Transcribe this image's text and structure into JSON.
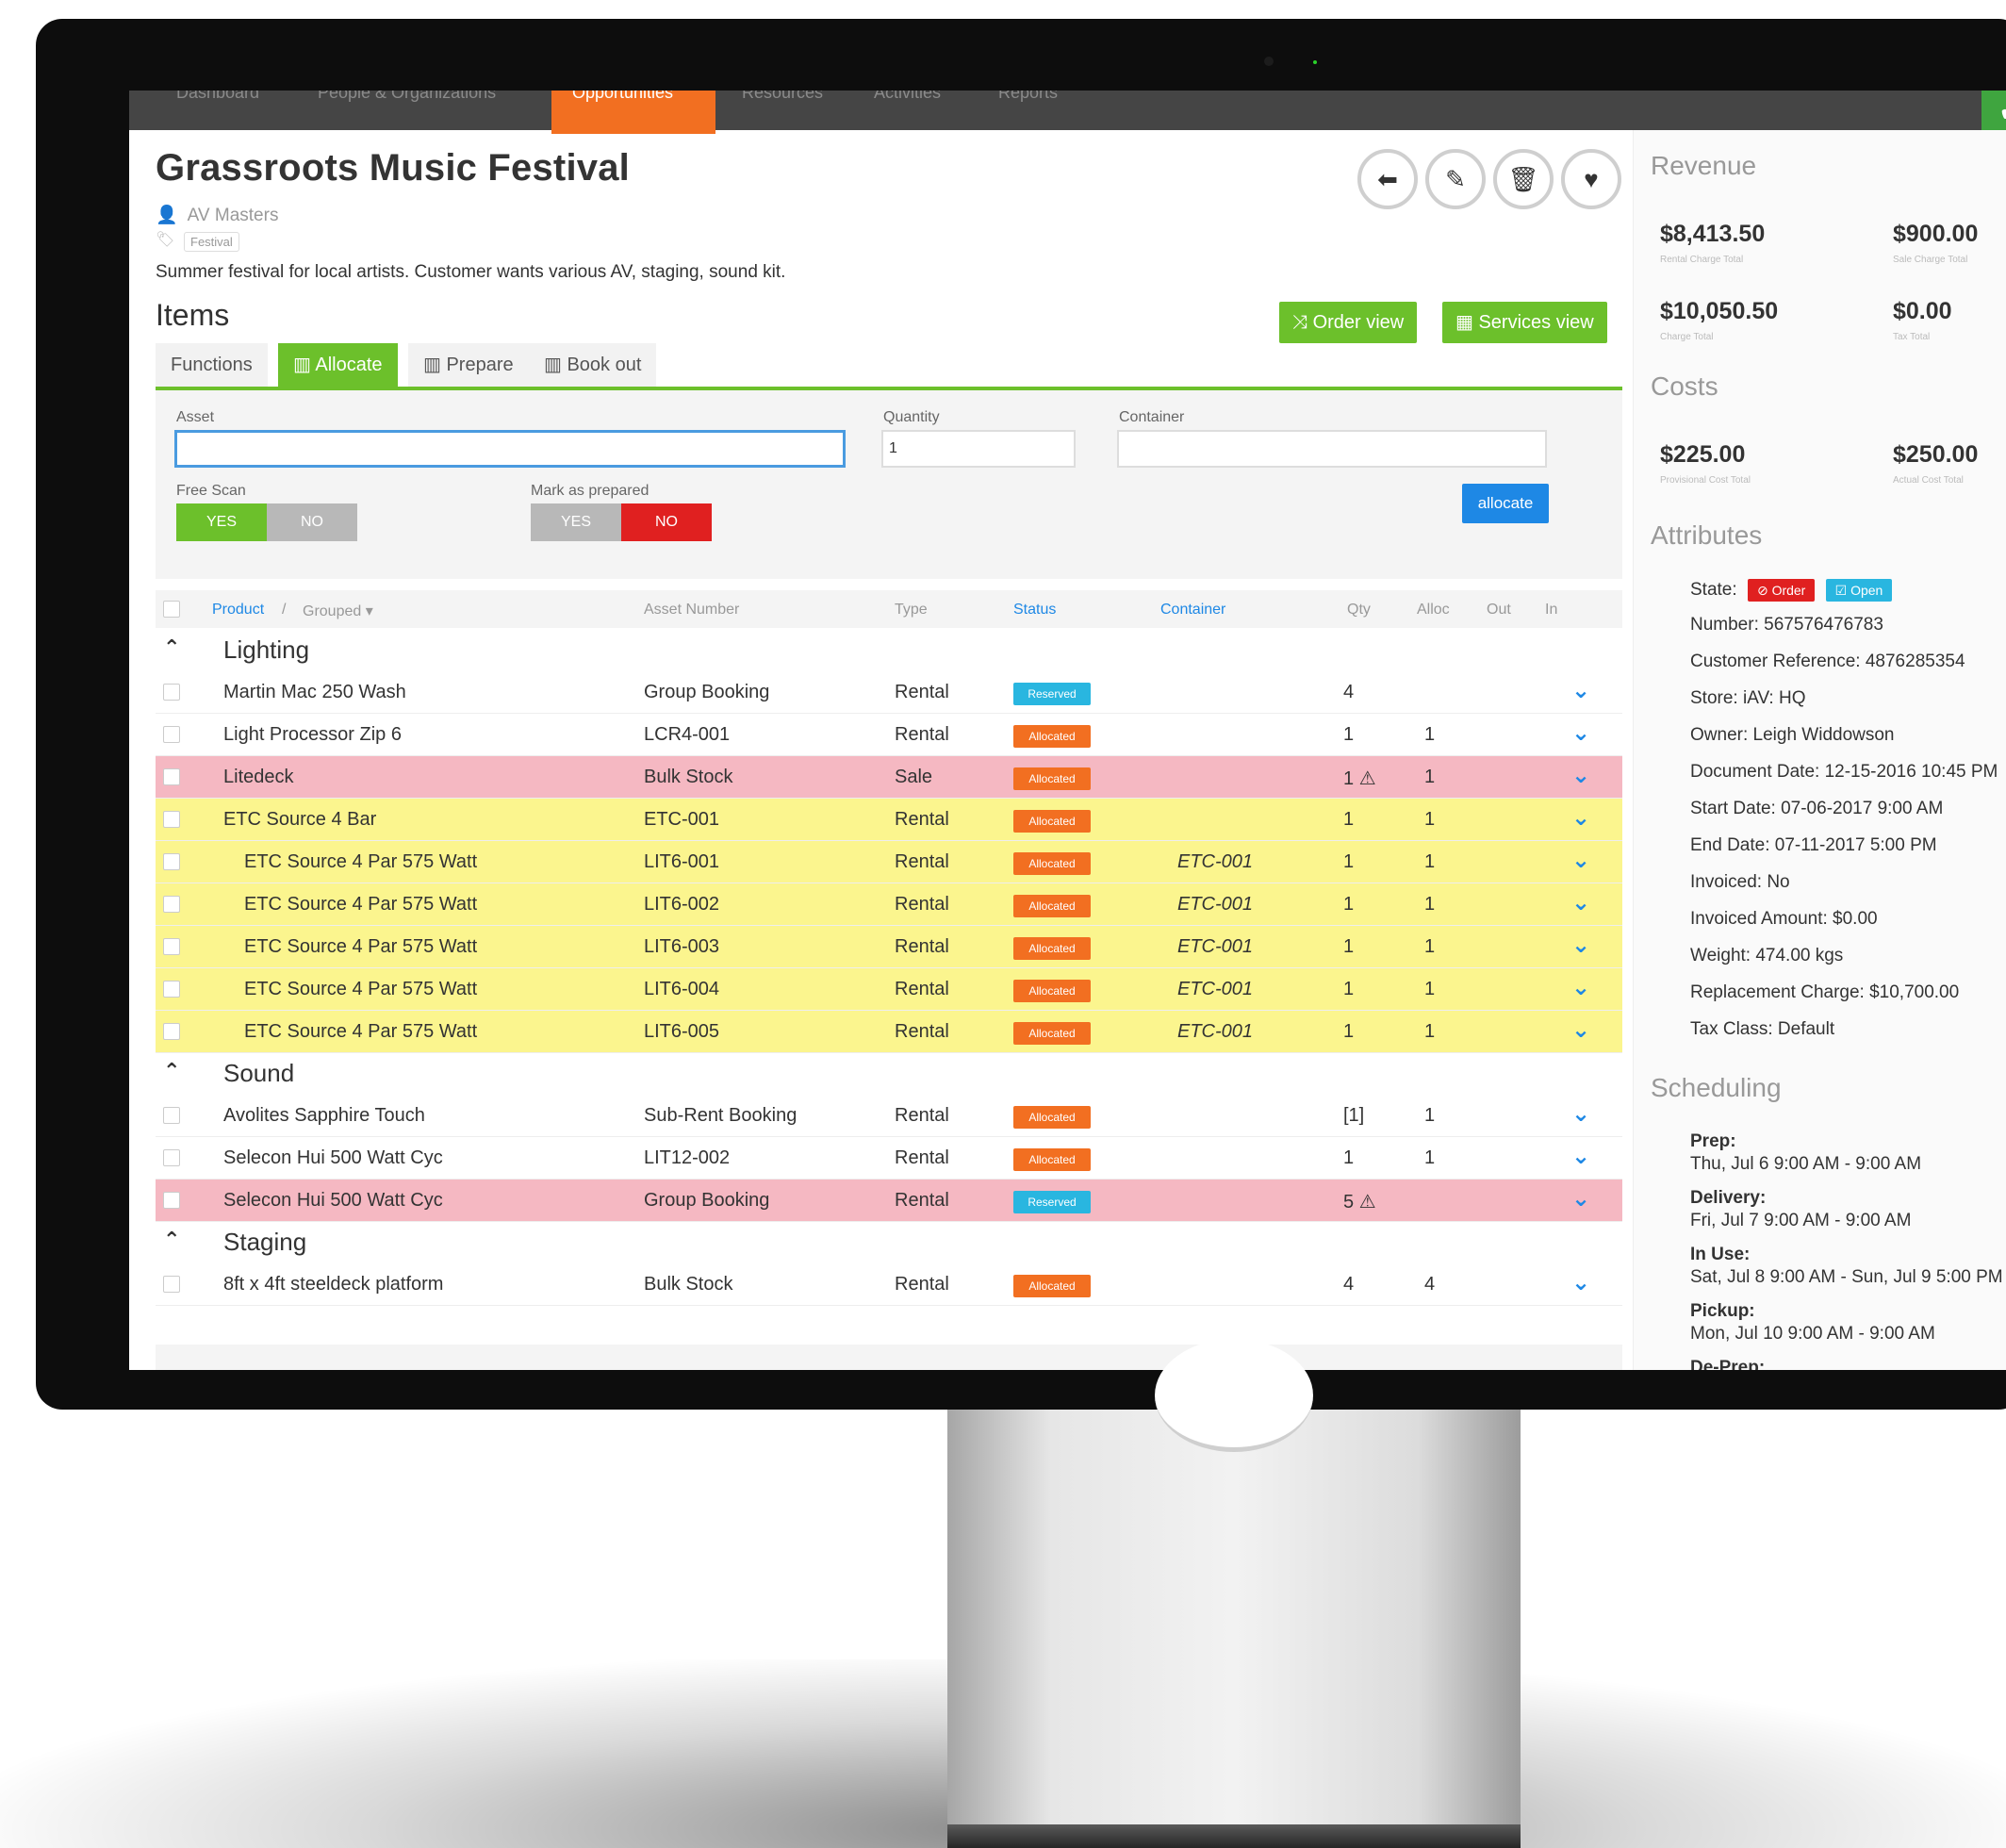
{
  "nav": {
    "items": [
      "Dashboard",
      "People & Organizations",
      "Opportunities",
      "Resources",
      "Activities",
      "Reports"
    ],
    "active": "Opportunities",
    "confirm_icon": "check-icon"
  },
  "header": {
    "title": "Grassroots Music Festival",
    "owner": "AV Masters",
    "tag": "Festival",
    "description": "Summer festival for local artists. Customer wants various AV, staging, sound kit.",
    "items_heading": "Items",
    "actions": [
      "back-arrow-icon",
      "pencil-icon",
      "trash-icon",
      "heart-icon"
    ]
  },
  "views": {
    "order_view": "Order view",
    "services_view": "Services view"
  },
  "tabs": [
    "Functions",
    "Allocate",
    "Prepare",
    "Book out"
  ],
  "active_tab": "Allocate",
  "form": {
    "asset_label": "Asset",
    "asset_value": "",
    "quantity_label": "Quantity",
    "quantity_value": "1",
    "container_label": "Container",
    "container_value": "",
    "free_scan_label": "Free Scan",
    "free_scan_yes": "YES",
    "free_scan_no": "NO",
    "mark_prepared_label": "Mark as prepared",
    "mark_prepared_yes": "YES",
    "mark_prepared_no": "NO",
    "allocate_button": "allocate"
  },
  "table": {
    "headers": {
      "product": "Product",
      "grouped": "Grouped",
      "asset_number": "Asset Number",
      "type": "Type",
      "status": "Status",
      "container": "Container",
      "qty": "Qty",
      "alloc": "Alloc",
      "out": "Out",
      "in": "In"
    },
    "groups": [
      {
        "name": "Lighting",
        "rows": [
          {
            "product": "Martin Mac 250 Wash",
            "asset": "Group Booking",
            "type": "Rental",
            "status": "Reserved",
            "container": "",
            "qty": "4",
            "alloc": "",
            "highlight": "none",
            "indent": false
          },
          {
            "product": "Light Processor Zip 6",
            "asset": "LCR4-001",
            "type": "Rental",
            "status": "Allocated",
            "container": "",
            "qty": "1",
            "alloc": "1",
            "highlight": "none",
            "indent": false
          },
          {
            "product": "Litedeck",
            "asset": "Bulk Stock",
            "type": "Sale",
            "status": "Allocated",
            "container": "",
            "qty": "1 ⚠",
            "alloc": "1",
            "highlight": "pink",
            "indent": false
          },
          {
            "product": "ETC Source 4 Bar",
            "asset": "ETC-001",
            "type": "Rental",
            "status": "Allocated",
            "container": "",
            "qty": "1",
            "alloc": "1",
            "highlight": "yellow",
            "indent": false
          },
          {
            "product": "ETC Source 4 Par 575 Watt",
            "asset": "LIT6-001",
            "type": "Rental",
            "status": "Allocated",
            "container": "ETC-001",
            "qty": "1",
            "alloc": "1",
            "highlight": "yellow",
            "indent": true
          },
          {
            "product": "ETC Source 4 Par 575 Watt",
            "asset": "LIT6-002",
            "type": "Rental",
            "status": "Allocated",
            "container": "ETC-001",
            "qty": "1",
            "alloc": "1",
            "highlight": "yellow",
            "indent": true
          },
          {
            "product": "ETC Source 4 Par 575 Watt",
            "asset": "LIT6-003",
            "type": "Rental",
            "status": "Allocated",
            "container": "ETC-001",
            "qty": "1",
            "alloc": "1",
            "highlight": "yellow",
            "indent": true
          },
          {
            "product": "ETC Source 4 Par 575 Watt",
            "asset": "LIT6-004",
            "type": "Rental",
            "status": "Allocated",
            "container": "ETC-001",
            "qty": "1",
            "alloc": "1",
            "highlight": "yellow",
            "indent": true
          },
          {
            "product": "ETC Source 4 Par 575 Watt",
            "asset": "LIT6-005",
            "type": "Rental",
            "status": "Allocated",
            "container": "ETC-001",
            "qty": "1",
            "alloc": "1",
            "highlight": "yellow",
            "indent": true
          }
        ]
      },
      {
        "name": "Sound",
        "rows": [
          {
            "product": "Avolites Sapphire Touch",
            "asset": "Sub-Rent Booking",
            "type": "Rental",
            "status": "Allocated",
            "container": "",
            "qty": "[1]",
            "alloc": "1",
            "highlight": "none",
            "indent": false
          },
          {
            "product": "Selecon Hui 500 Watt Cyc",
            "asset": "LIT12-002",
            "type": "Rental",
            "status": "Allocated",
            "container": "",
            "qty": "1",
            "alloc": "1",
            "highlight": "none",
            "indent": false
          },
          {
            "product": "Selecon Hui 500 Watt Cyc",
            "asset": "Group Booking",
            "type": "Rental",
            "status": "Reserved",
            "container": "",
            "qty": "5 ⚠",
            "alloc": "",
            "highlight": "pink",
            "indent": false
          }
        ]
      },
      {
        "name": "Staging",
        "rows": [
          {
            "product": "8ft x 4ft steeldeck platform",
            "asset": "Bulk Stock",
            "type": "Rental",
            "status": "Allocated",
            "container": "",
            "qty": "4",
            "alloc": "4",
            "highlight": "none",
            "indent": false
          }
        ]
      }
    ]
  },
  "sidebar": {
    "revenue_heading": "Revenue",
    "revenue": [
      {
        "value": "$8,413.50",
        "label": "Rental Charge Total"
      },
      {
        "value": "$900.00",
        "label": "Sale Charge Total"
      },
      {
        "value": "$10,050.50",
        "label": "Charge Total"
      },
      {
        "value": "$0.00",
        "label": "Tax Total"
      }
    ],
    "costs_heading": "Costs",
    "costs": [
      {
        "value": "$225.00",
        "label": "Provisional Cost Total"
      },
      {
        "value": "$250.00",
        "label": "Actual Cost Total"
      }
    ],
    "attributes_heading": "Attributes",
    "state_label": "State:",
    "state_badges": [
      {
        "text": "Order",
        "color": "#e02020"
      },
      {
        "text": "Open",
        "color": "#29b6e0"
      }
    ],
    "attributes": [
      "Number: 567576476783",
      "Customer Reference: 4876285354",
      "Store: iAV: HQ",
      "Owner: Leigh Widdowson",
      "Document Date: 12-15-2016 10:45 PM",
      "Start Date: 07-06-2017 9:00 AM",
      "End Date: 07-11-2017 5:00 PM",
      "Invoiced: No",
      "Invoiced Amount: $0.00",
      "Weight: 474.00 kgs",
      "Replacement Charge: $10,700.00",
      "Tax Class: Default"
    ],
    "scheduling_heading": "Scheduling",
    "scheduling": [
      {
        "label": "Prep:",
        "value": "Thu, Jul 6 9:00 AM - 9:00 AM"
      },
      {
        "label": "Delivery:",
        "value": "Fri, Jul 7 9:00 AM - 9:00 AM"
      },
      {
        "label": "In Use:",
        "value": "Sat, Jul 8 9:00 AM - Sun, Jul 9 5:00 PM"
      },
      {
        "label": "Pickup:",
        "value": "Mon, Jul 10 9:00 AM - 9:00 AM"
      },
      {
        "label": "De-Prep:",
        "value": ""
      }
    ]
  },
  "colors": {
    "nav_active": "#f26f21",
    "green": "#6cc02b",
    "blue": "#1e88e5",
    "allocated": "#f26f21",
    "reserved": "#29b6e0",
    "pink_row": "#f5b8c2",
    "yellow_row": "#fbf58e"
  }
}
